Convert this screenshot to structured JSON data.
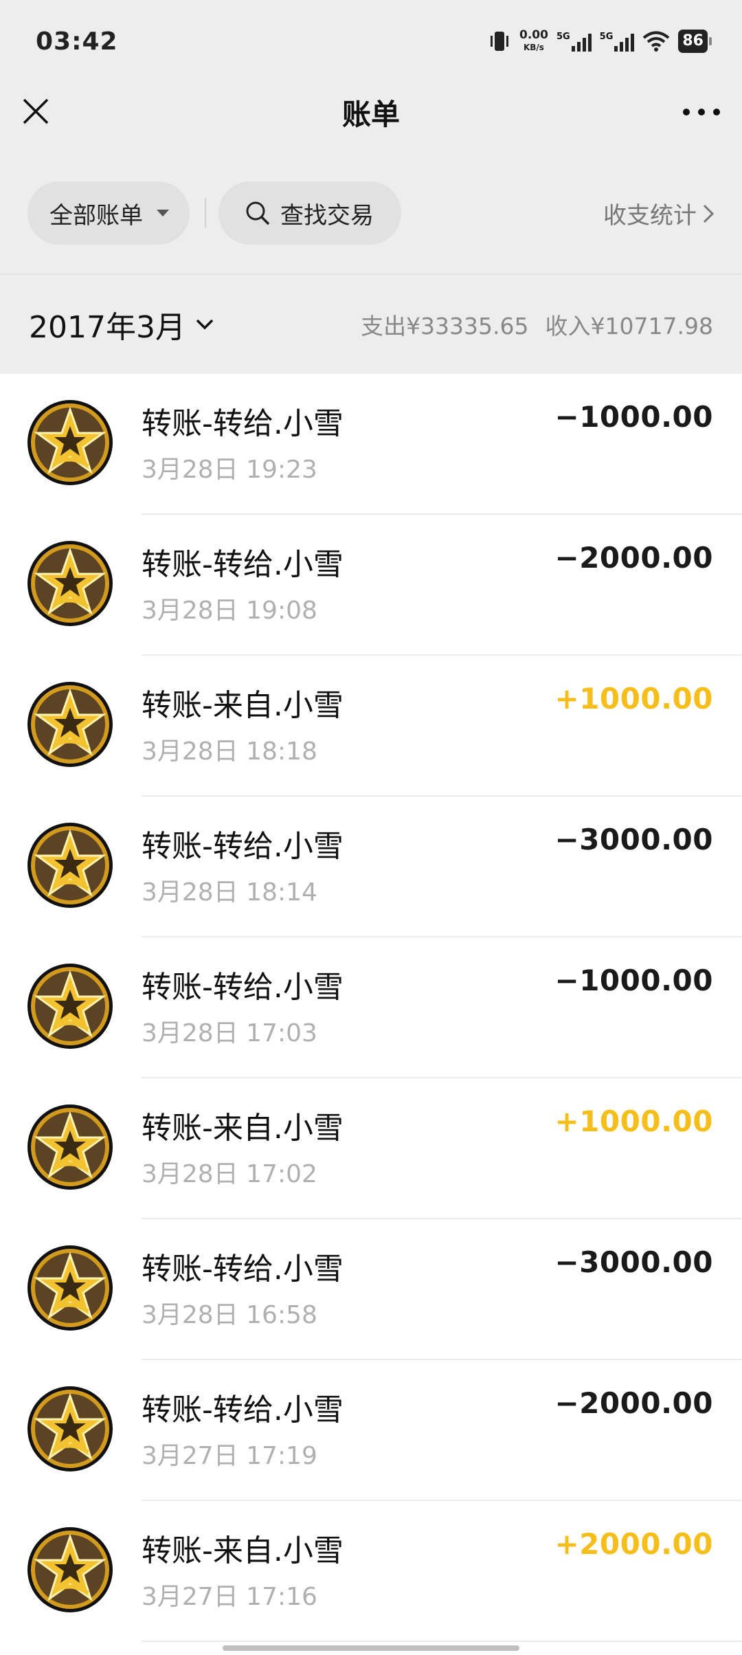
{
  "status_bar": {
    "time": "03:42",
    "speed_value": "0.00",
    "speed_unit": "KB/s",
    "signal1_label": "5G",
    "signal2_label": "5G",
    "battery": "86"
  },
  "navbar": {
    "title": "账单"
  },
  "filters": {
    "all_bills": "全部账单",
    "search": "查找交易",
    "stats": "收支统计"
  },
  "month": {
    "label": "2017年3月",
    "expense": "支出¥33335.65",
    "income": "收入¥10717.98"
  },
  "colors": {
    "income_accent": "#f6be1a",
    "background": "#ededed"
  },
  "transactions": [
    {
      "title": "转账-转给.小雪",
      "time": "3月28日 19:23",
      "amount": "−1000.00",
      "type": "expense"
    },
    {
      "title": "转账-转给.小雪",
      "time": "3月28日 19:08",
      "amount": "−2000.00",
      "type": "expense"
    },
    {
      "title": "转账-来自.小雪",
      "time": "3月28日 18:18",
      "amount": "+1000.00",
      "type": "income"
    },
    {
      "title": "转账-转给.小雪",
      "time": "3月28日 18:14",
      "amount": "−3000.00",
      "type": "expense"
    },
    {
      "title": "转账-转给.小雪",
      "time": "3月28日 17:03",
      "amount": "−1000.00",
      "type": "expense"
    },
    {
      "title": "转账-来自.小雪",
      "time": "3月28日 17:02",
      "amount": "+1000.00",
      "type": "income"
    },
    {
      "title": "转账-转给.小雪",
      "time": "3月28日 16:58",
      "amount": "−3000.00",
      "type": "expense"
    },
    {
      "title": "转账-转给.小雪",
      "time": "3月27日 17:19",
      "amount": "−2000.00",
      "type": "expense"
    },
    {
      "title": "转账-来自.小雪",
      "time": "3月27日 17:16",
      "amount": "+2000.00",
      "type": "income"
    }
  ]
}
